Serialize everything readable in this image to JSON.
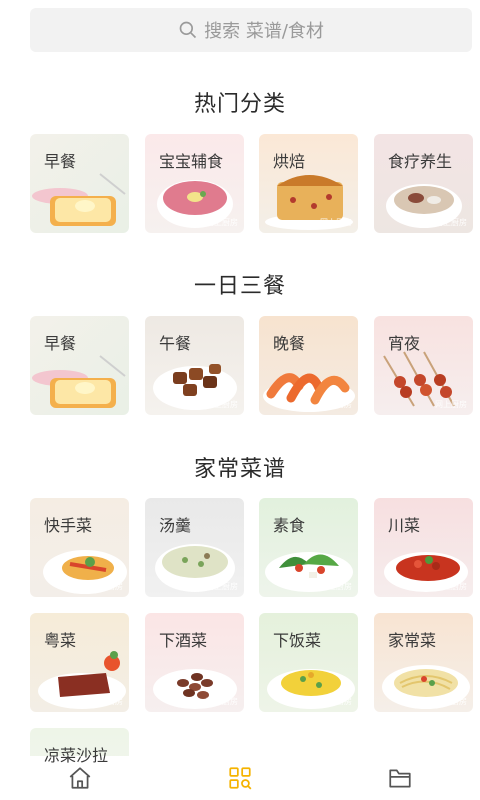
{
  "search": {
    "placeholder": "搜索 菜谱/食材"
  },
  "sections": [
    {
      "title": "热门分类",
      "items": [
        {
          "label": "早餐",
          "watermark": ""
        },
        {
          "label": "宝宝辅食",
          "watermark": "网上厨房"
        },
        {
          "label": "烘焙",
          "watermark": "网上厨房"
        },
        {
          "label": "食疗养生",
          "watermark": "网上厨房"
        }
      ]
    },
    {
      "title": "一日三餐",
      "items": [
        {
          "label": "早餐",
          "watermark": ""
        },
        {
          "label": "午餐",
          "watermark": "网上厨房"
        },
        {
          "label": "晚餐",
          "watermark": "网上厨房"
        },
        {
          "label": "宵夜",
          "watermark": "网上厨房"
        }
      ]
    },
    {
      "title": "家常菜谱",
      "items": [
        {
          "label": "快手菜",
          "watermark": "网上厨房"
        },
        {
          "label": "汤羹",
          "watermark": "网上厨房"
        },
        {
          "label": "素食",
          "watermark": "网上厨房"
        },
        {
          "label": "川菜",
          "watermark": "网上厨房"
        },
        {
          "label": "粤菜",
          "watermark": "网上厨房"
        },
        {
          "label": "下酒菜",
          "watermark": "网上厨房"
        },
        {
          "label": "下饭菜",
          "watermark": "网上厨房"
        },
        {
          "label": "家常菜",
          "watermark": "网上厨房"
        },
        {
          "label": "凉菜沙拉",
          "watermark": ""
        }
      ]
    }
  ],
  "nav": {
    "icons": [
      "home-icon",
      "category-icon",
      "folder-icon"
    ],
    "active_color": "#f5b300",
    "inactive_color": "#555555"
  }
}
